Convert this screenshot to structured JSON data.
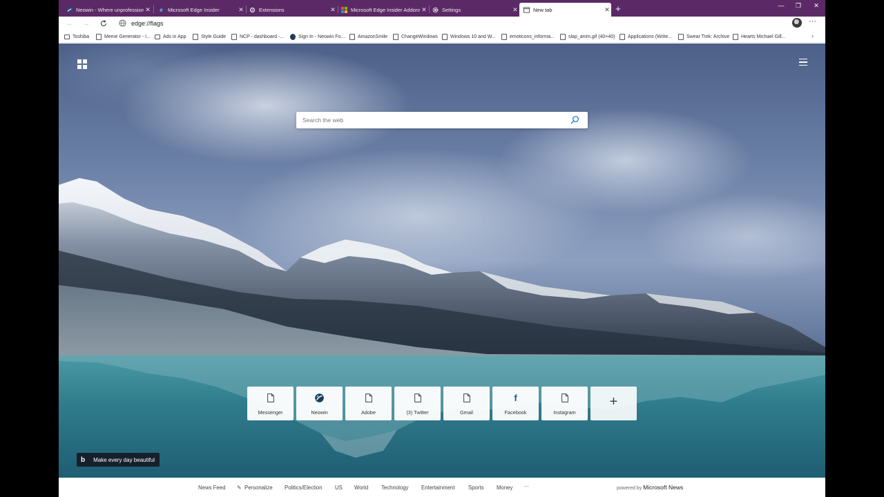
{
  "colors": {
    "tabstrip": "#5b2a66",
    "accent": "#0078d4"
  },
  "tabs": [
    {
      "title": "Neowin - Where unprofessional",
      "icon": "neowin-icon"
    },
    {
      "title": "Microsoft Edge Insider",
      "icon": "edge-icon"
    },
    {
      "title": "Extensions",
      "icon": "extensions-gear-icon"
    },
    {
      "title": "Microsoft Edge Insider Addons",
      "icon": "microsoft-logo-icon"
    },
    {
      "title": "Settings",
      "icon": "settings-gear-icon"
    },
    {
      "title": "New tab",
      "icon": "new-tab-page-icon"
    }
  ],
  "address_bar": {
    "url": "edge://flags"
  },
  "favorites": [
    {
      "label": "Toshiba",
      "icon": "folder-icon"
    },
    {
      "label": "Meme Generator - I...",
      "icon": "page-icon"
    },
    {
      "label": "Ads in App",
      "icon": "folder-icon"
    },
    {
      "label": "Style Guide",
      "icon": "page-icon"
    },
    {
      "label": "NCP - dashboard -...",
      "icon": "page-icon"
    },
    {
      "label": "Sign In - Neowin Fo...",
      "icon": "neowin-icon"
    },
    {
      "label": "AmazonSmile",
      "icon": "page-icon"
    },
    {
      "label": "ChangeWindows",
      "icon": "page-icon"
    },
    {
      "label": "Windows 10 and W...",
      "icon": "page-icon"
    },
    {
      "label": "emoticons_informa...",
      "icon": "page-icon"
    },
    {
      "label": "slap_anim.gif (40×40)",
      "icon": "page-icon"
    },
    {
      "label": "Applications (Write...",
      "icon": "page-icon"
    },
    {
      "label": "Swear Trek: Archive",
      "icon": "page-icon"
    },
    {
      "label": "Hearts Michael Gill...",
      "icon": "page-icon"
    }
  ],
  "search": {
    "placeholder": "Search the web"
  },
  "quick_links": [
    {
      "label": "Messenger",
      "icon": "page-icon"
    },
    {
      "label": "Neowin",
      "icon": "neowin-icon"
    },
    {
      "label": "Adobe",
      "icon": "page-icon"
    },
    {
      "label": "(3) Twitter",
      "icon": "page-icon"
    },
    {
      "label": "Gmail",
      "icon": "page-icon"
    },
    {
      "label": "Facebook",
      "icon": "facebook-icon"
    },
    {
      "label": "Instagram",
      "icon": "page-icon"
    }
  ],
  "quick_link_add": "+",
  "bing": {
    "logo": "b",
    "tagline": "Make every day beautiful"
  },
  "news_nav": {
    "items": [
      "News Feed",
      "Personalize",
      "Politics/Election",
      "US",
      "World",
      "Technology",
      "Entertainment",
      "Sports",
      "Money",
      "···"
    ],
    "powered_by": "powered by",
    "brand": "Microsoft News"
  }
}
